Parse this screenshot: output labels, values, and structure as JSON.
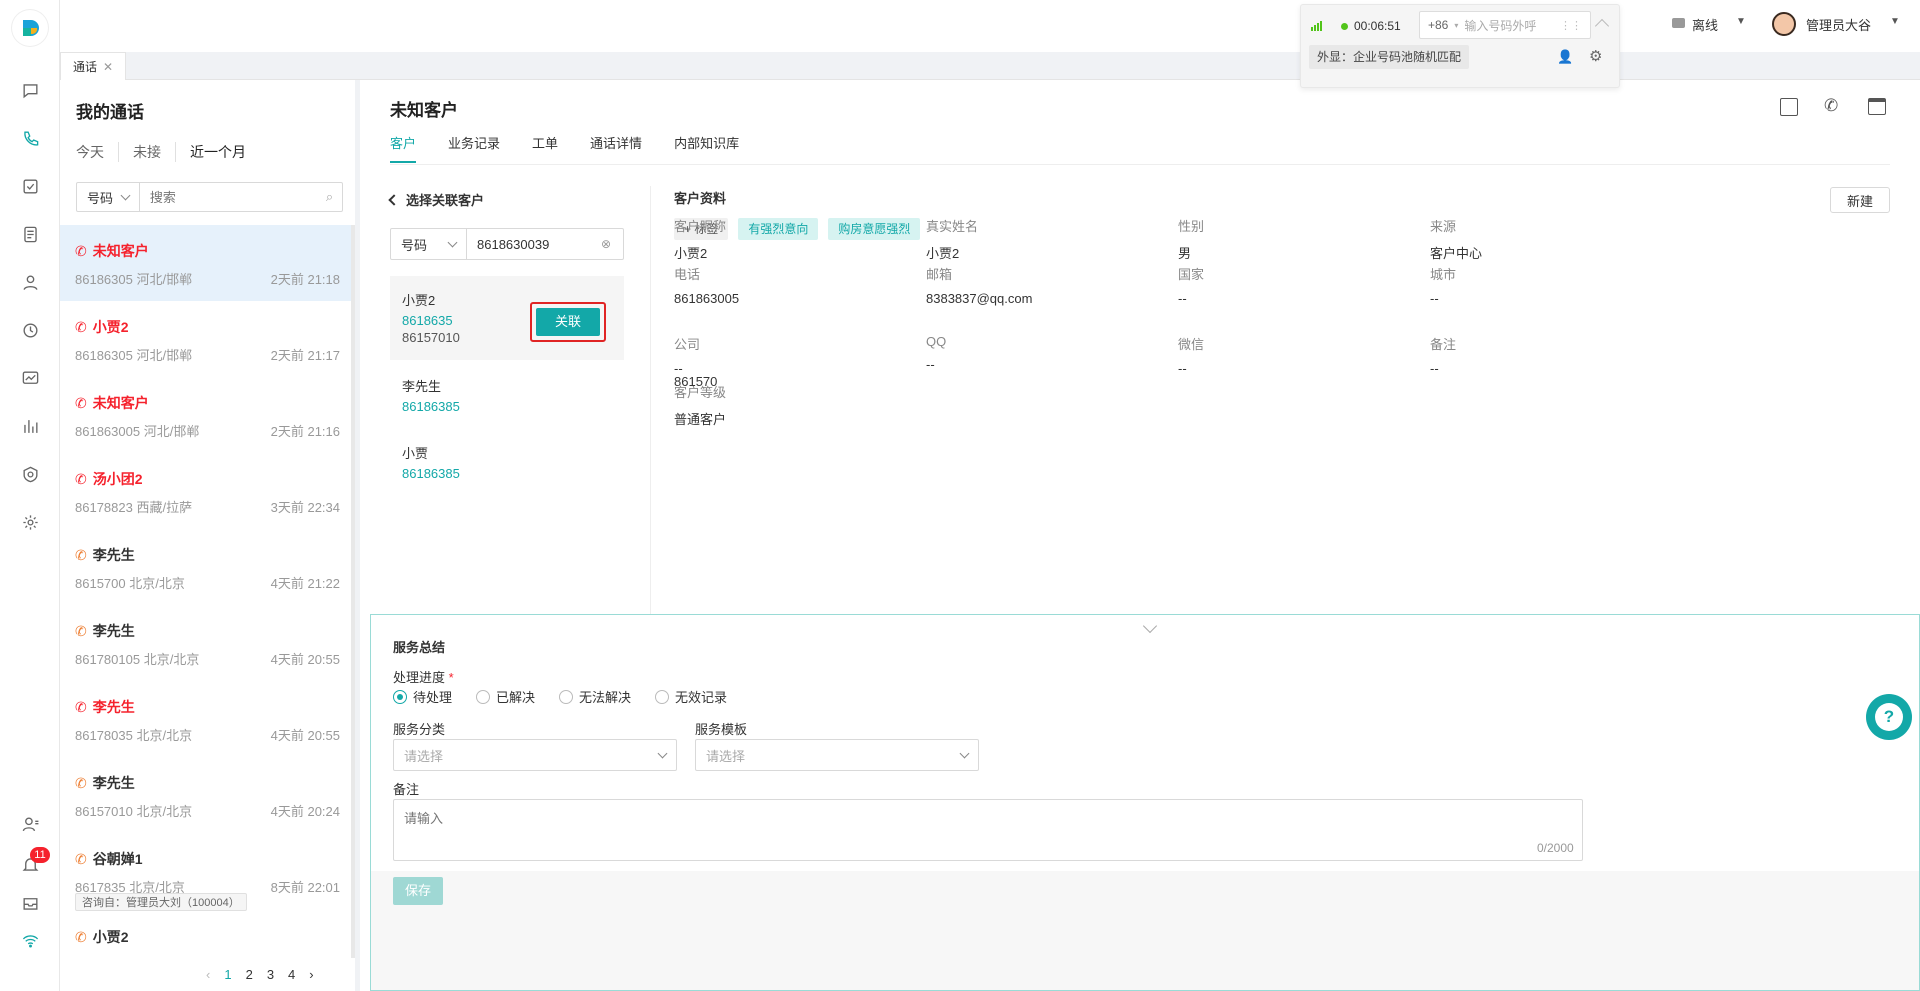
{
  "topbar": {
    "timer": "00:06:51",
    "country_code": "+86",
    "dial_placeholder": "输入号码外呼",
    "caller_display": "外显：企业号码池随机匹配",
    "status": "离线",
    "user": "管理员大谷"
  },
  "tabs": [
    {
      "label": "通话"
    }
  ],
  "left": {
    "title": "我的通话",
    "filters": [
      "今天",
      "未接",
      "近一个月"
    ],
    "search_type": "号码",
    "search_placeholder": "搜索",
    "calls": [
      {
        "name": "未知客户",
        "number": "86186305",
        "location": "河北/邯郸",
        "time": "2天前 21:18",
        "missed": true
      },
      {
        "name": "小贾2",
        "number": "86186305",
        "location": "河北/邯郸",
        "time": "2天前 21:17",
        "missed": true
      },
      {
        "name": "未知客户",
        "number": "861863005",
        "location": "河北/邯郸",
        "time": "2天前 21:16",
        "missed": true
      },
      {
        "name": "汤小团2",
        "number": "86178823",
        "location": "西藏/拉萨",
        "time": "3天前 22:34",
        "missed": true
      },
      {
        "name": "李先生",
        "number": "8615700",
        "location": "北京/北京",
        "time": "4天前 21:22",
        "missed": false
      },
      {
        "name": "李先生",
        "number": "861780105",
        "location": "北京/北京",
        "time": "4天前 20:55",
        "missed": false
      },
      {
        "name": "李先生",
        "number": "86178035",
        "location": "北京/北京",
        "time": "4天前 20:55",
        "missed": true
      },
      {
        "name": "李先生",
        "number": "86157010",
        "location": "北京/北京",
        "time": "4天前 20:24",
        "missed": false
      },
      {
        "name": "谷朝婵1",
        "number": "8617835",
        "location": "北京/北京",
        "time": "8天前 22:01",
        "missed": false
      },
      {
        "name": "小贾2",
        "number": "",
        "location": "",
        "time": "",
        "missed": false
      }
    ],
    "consult_tag": "咨询自：管理员大刘（100004）",
    "pages": [
      "1",
      "2",
      "3",
      "4"
    ],
    "notify_count": "11"
  },
  "main": {
    "title": "未知客户",
    "tabs": [
      "客户",
      "业务记录",
      "工单",
      "通话详情",
      "内部知识库"
    ],
    "assoc": {
      "back_label": "选择关联客户",
      "search_type": "号码",
      "search_value": "8618630039",
      "link_button": "关联",
      "results": [
        {
          "name": "小贾2",
          "phone1": "8618635",
          "phone2": "86157010"
        },
        {
          "name": "李先生",
          "phone1": "86186385"
        },
        {
          "name": "小贾",
          "phone1": "86186385"
        }
      ]
    },
    "profile": {
      "title": "客户资料",
      "new_button": "新建",
      "tag_add": "+ 标签",
      "tags": [
        "有强烈意向",
        "购房意愿强烈"
      ],
      "fields": [
        {
          "label": "客户昵称",
          "value": "小贾2"
        },
        {
          "label": "真实姓名",
          "value": "小贾2"
        },
        {
          "label": "性别",
          "value": "男"
        },
        {
          "label": "来源",
          "value": "客户中心"
        },
        {
          "label": "电话",
          "value": "861863005"
        },
        {
          "label": "邮箱",
          "value": "8383837@qq.com"
        },
        {
          "label": "国家",
          "value": "--"
        },
        {
          "label": "城市",
          "value": "--"
        },
        {
          "label": "公司",
          "value": "--"
        },
        {
          "label": "QQ",
          "value": "--"
        },
        {
          "label": "微信",
          "value": "--"
        },
        {
          "label": "备注",
          "value": "--"
        },
        {
          "label": "客户等级",
          "value": "普通客户"
        }
      ],
      "phone_extra": "861570"
    },
    "summary": {
      "title": "服务总结",
      "progress_label": "处理进度",
      "options": [
        "待处理",
        "已解决",
        "无法解决",
        "无效记录"
      ],
      "category_label": "服务分类",
      "template_label": "服务模板",
      "select_placeholder": "请选择",
      "remark_label": "备注",
      "remark_placeholder": "请输入",
      "counter": "0/2000",
      "save": "保存"
    }
  }
}
